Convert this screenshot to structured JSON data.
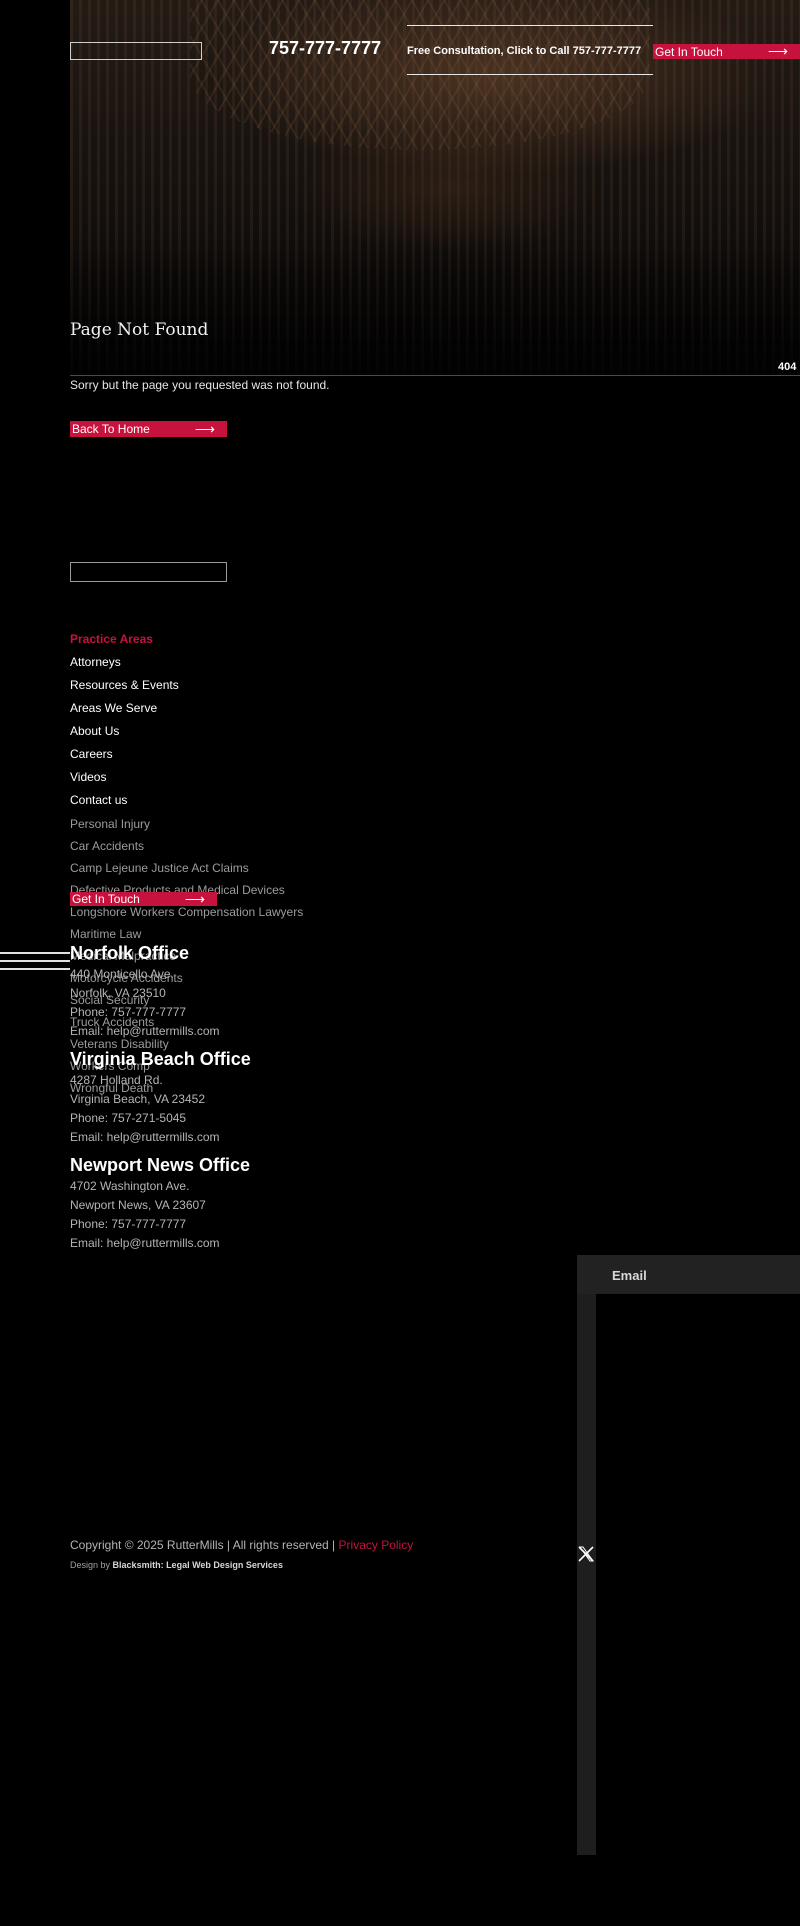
{
  "header": {
    "phone_display": "757-777-7777",
    "consultation_text": "Free Consultation, Click to Call 757-777-7777",
    "cta_label": "Get In Touch"
  },
  "hero": {
    "title": "Page Not Found",
    "error_code": "404"
  },
  "main": {
    "message": "Sorry but the page you requested was not found.",
    "back_button_label": "Back To Home"
  },
  "footer": {
    "nav": [
      {
        "label": "Practice Areas",
        "active": true
      },
      {
        "label": "Attorneys"
      },
      {
        "label": "Resources & Events"
      },
      {
        "label": "Areas We Serve"
      },
      {
        "label": "About Us"
      },
      {
        "label": "Careers"
      },
      {
        "label": "Videos"
      },
      {
        "label": "Contact us"
      }
    ],
    "practice_areas": [
      "Personal Injury",
      "Car Accidents",
      "Camp Lejeune Justice Act Claims",
      "Defective Products and Medical Devices",
      "Longshore Workers Compensation Lawyers",
      "Maritime Law",
      "Medical Malpractice",
      "Motorcycle Accidents",
      "Social Security",
      "Truck Accidents",
      "Veterans Disability",
      "Workers Comp",
      "Wrongful Death"
    ],
    "cta_label": "Get In Touch",
    "offices": [
      {
        "name": "Norfolk Office",
        "street": "440 Monticello Ave.",
        "city": "Norfolk, VA 23510",
        "phone": "Phone: 757-777-7777",
        "email": "Email: help@ruttermills.com"
      },
      {
        "name": "Virginia Beach Office",
        "street": "4287 Holland Rd.",
        "city": "Virginia Beach, VA 23452",
        "phone": "Phone: 757-271-5045",
        "email": "Email: help@ruttermills.com"
      },
      {
        "name": "Newport News Office",
        "street": "4702 Washington Ave.",
        "city": "Newport News, VA 23607",
        "phone": "Phone: 757-777-7777",
        "email": "Email: help@ruttermills.com"
      }
    ],
    "subscribe_label": "Email",
    "copyright": "Copyright © 2025 RutterMills | All rights reserved |",
    "privacy_label": "Privacy Policy",
    "design_prefix": "Design by",
    "design_credit": "Blacksmith: Legal Web Design Services",
    "social_icon": "x-twitter-icon"
  },
  "colors": {
    "accent": "#c8123e",
    "background": "#000000"
  }
}
